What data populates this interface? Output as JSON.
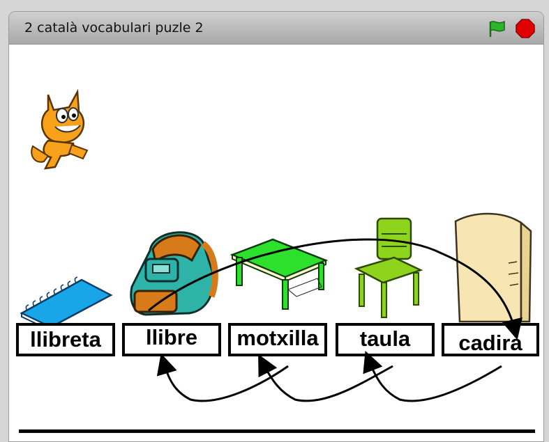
{
  "window": {
    "title": "2 català vocabulari puzle 2"
  },
  "controls": {
    "green_flag_icon": "green-flag-icon",
    "stop_icon": "stop-sign-icon"
  },
  "colors": {
    "flag": "#2bb52b",
    "stop": "#e00000",
    "titlebar": "#bdbdbd"
  },
  "words": [
    {
      "label": "llibreta"
    },
    {
      "label": "llibre"
    },
    {
      "label": "motxilla"
    },
    {
      "label": "taula"
    },
    {
      "label": "cadira"
    }
  ],
  "sprites": [
    "cat-sprite",
    "notebook-sprite",
    "backpack-sprite",
    "table-sprite",
    "chair-sprite",
    "book-sprite"
  ]
}
